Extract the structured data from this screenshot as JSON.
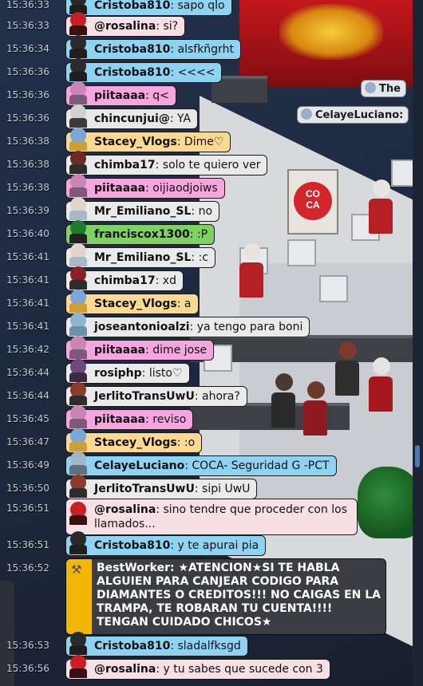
{
  "room": {
    "banner_text_top": "CO",
    "banner_text_bottom": "CA",
    "floating_labels": [
      {
        "name": "The"
      },
      {
        "name": "CelayeLuciano:"
      }
    ]
  },
  "chat": [
    {
      "time": "15:36:33",
      "user": "Cristoba810",
      "message": "sapo qlo",
      "color": "#8fd3f2"
    },
    {
      "time": "15:36:33",
      "user": "@rosalina",
      "message": "si?",
      "color": "#f6dfe5"
    },
    {
      "time": "15:36:34",
      "user": "Cristoba810",
      "message": "alsfkñgrht",
      "color": "#8fd3f2"
    },
    {
      "time": "15:36:36",
      "user": "Cristoba810",
      "message": "<<<<",
      "color": "#8fd3f2"
    },
    {
      "time": "15:36:36",
      "user": "piitaaaa",
      "message": "q<",
      "color": "#f5a6df"
    },
    {
      "time": "15:36:36",
      "user": "chincunjui@",
      "message": "YA",
      "color": "#e8e8e8"
    },
    {
      "time": "15:36:38",
      "user": "Stacey_Vlogs",
      "message": "Dime♡",
      "color": "#fcd992"
    },
    {
      "time": "15:36:38",
      "user": "chimba17",
      "message": "solo te quiero ver",
      "color": "#eaeaea"
    },
    {
      "time": "15:36:38",
      "user": "piitaaaa",
      "message": "oijiaodjoiws",
      "color": "#f5a6df"
    },
    {
      "time": "15:36:39",
      "user": "Mr_Emiliano_SL",
      "message": "no",
      "color": "#eaeaea"
    },
    {
      "time": "15:36:40",
      "user": "franciscox1300",
      "message": ":P",
      "color": "#7fd262"
    },
    {
      "time": "15:36:41",
      "user": "Mr_Emiliano_SL",
      "message": ":c",
      "color": "#eaeaea"
    },
    {
      "time": "15:36:41",
      "user": "chimba17",
      "message": "xd",
      "color": "#eaeaea"
    },
    {
      "time": "15:36:41",
      "user": "Stacey_Vlogs",
      "message": "a",
      "color": "#fcd992"
    },
    {
      "time": "15:36:41",
      "user": "joseantonioalzi",
      "message": "ya tengo para boni",
      "color": "#eaeaea"
    },
    {
      "time": "15:36:42",
      "user": "piitaaaa",
      "message": "dime jose",
      "color": "#f5a6df"
    },
    {
      "time": "15:36:44",
      "user": "rosiphp",
      "message": "listo♡",
      "color": "#eaeaea"
    },
    {
      "time": "15:36:44",
      "user": "JerlitoTransUwU",
      "message": "ahora?",
      "color": "#eaeaea"
    },
    {
      "time": "15:36:45",
      "user": "piitaaaa",
      "message": "reviso",
      "color": "#f5a6df"
    },
    {
      "time": "15:36:47",
      "user": "Stacey_Vlogs",
      "message": ":o",
      "color": "#fcd992"
    },
    {
      "time": "15:36:49",
      "user": "CelayeLuciano",
      "message": "COCA- Seguridad G -PCT",
      "color": "#8fd3f2"
    },
    {
      "time": "15:36:50",
      "user": "JerlitoTransUwU",
      "message": "sipi UwU",
      "color": "#eaeaea"
    },
    {
      "time": "15:36:51",
      "user": "@rosalina",
      "message": "sino tendre que proceder con los llamados...",
      "color": "#f6dfe5"
    },
    {
      "time": "15:36:51",
      "user": "Cristoba810",
      "message": "y te apurai pia",
      "color": "#8fd3f2"
    },
    {
      "time": "15:36:52",
      "user": "BestWorker",
      "message": "★ATENCION★SI TE HABLA ALGUIEN PARA CANJEAR CODIGO PARA DIAMANTES O CREDITOS!!! NO CAIGAS EN LA TRAMPA, TE ROBARAN TU CUENTA!!!! TENGAN CUIDADO CHICOS★",
      "color": "#3b3d42"
    },
    {
      "time": "15:36:53",
      "user": "Cristoba810",
      "message": "sladalfksgd",
      "color": "#8fd3f2"
    },
    {
      "time": "15:36:56",
      "user": "@rosalina",
      "message": "y tu sabes que sucede con 3",
      "color": "#f6dfe5"
    }
  ]
}
